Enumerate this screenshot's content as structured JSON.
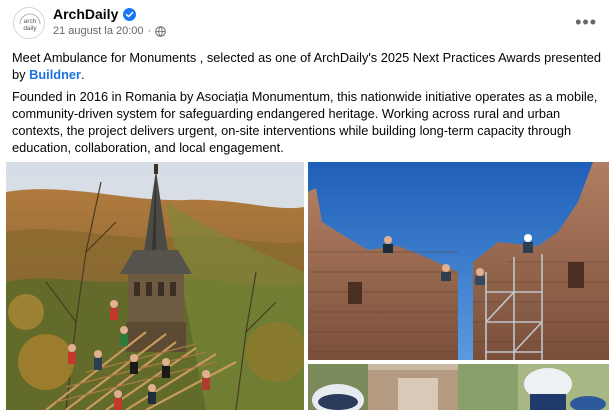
{
  "post": {
    "author": "ArchDaily",
    "avatar_text_1": "arch",
    "avatar_text_2": "daily",
    "date": "21 august la 20:00",
    "separator": "·",
    "more_label": "•••",
    "p1_before": "Meet  Ambulance for Monuments , selected as one of ArchDaily's 2025 Next Practices Awards presented by ",
    "p1_link": "Buildner",
    "p1_after": ".",
    "p2": "Founded in 2016 in Romania by Asociația Monumentum, this nationwide initiative operates as a mobile, community-driven system for safeguarding endangered heritage. Working across rural and urban contexts, the project delivers urgent, on-site interventions while building long-term capacity through education, collaboration, and local engagement."
  },
  "icons": {
    "verified": "verified-badge-icon",
    "privacy": "globe-icon",
    "more": "more-options-icon"
  },
  "colors": {
    "verified_blue": "#1877f2",
    "link_blue": "#1b74e4",
    "meta_gray": "#65676b"
  }
}
